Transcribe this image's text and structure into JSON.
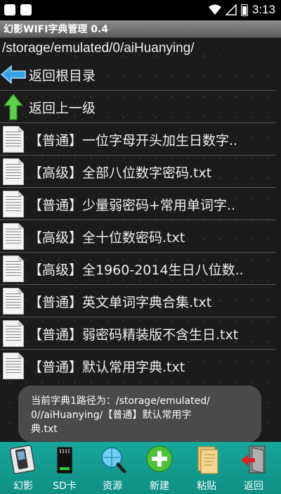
{
  "status_bar": {
    "time": "3:13"
  },
  "app": {
    "title": "幻影WIFI字典管理 0.4"
  },
  "path": "/storage/emulated/0/aiHuanying/",
  "nav": [
    {
      "label": "返回根目录",
      "icon": "arrow-left-icon"
    },
    {
      "label": "返回上一级",
      "icon": "arrow-up-icon"
    }
  ],
  "files": [
    {
      "label": "【普通】一位字母开头加生日数字.."
    },
    {
      "label": "【高级】全部八位数字密码.txt"
    },
    {
      "label": "【普通】少量弱密码+常用单词字.."
    },
    {
      "label": "【高级】全十位数密码.txt"
    },
    {
      "label": "【高级】全1960-2014生日八位数.."
    },
    {
      "label": "【普通】英文单词字典合集.txt"
    },
    {
      "label": "【普通】弱密码精装版不含生日.txt"
    },
    {
      "label": "【普通】默认常用字典.txt"
    }
  ],
  "toast": {
    "line1": "当前字典1路径为：/storage/emulated/",
    "line2": "0//aiHuanying/【普通】默认常用字",
    "line3": "典.txt"
  },
  "bottom_bar": [
    {
      "label": "幻影",
      "icon": "phone-icon"
    },
    {
      "label": "SD卡",
      "icon": "sd-card-icon"
    },
    {
      "label": "资源",
      "icon": "globe-search-icon"
    },
    {
      "label": "新建",
      "icon": "plus-circle-icon"
    },
    {
      "label": "粘贴",
      "icon": "paste-icon"
    },
    {
      "label": "返回",
      "icon": "exit-door-icon"
    }
  ],
  "colors": {
    "accent": "#17a79b",
    "title_bar": "#7a7a7a",
    "toast": "#4a4a4a"
  }
}
